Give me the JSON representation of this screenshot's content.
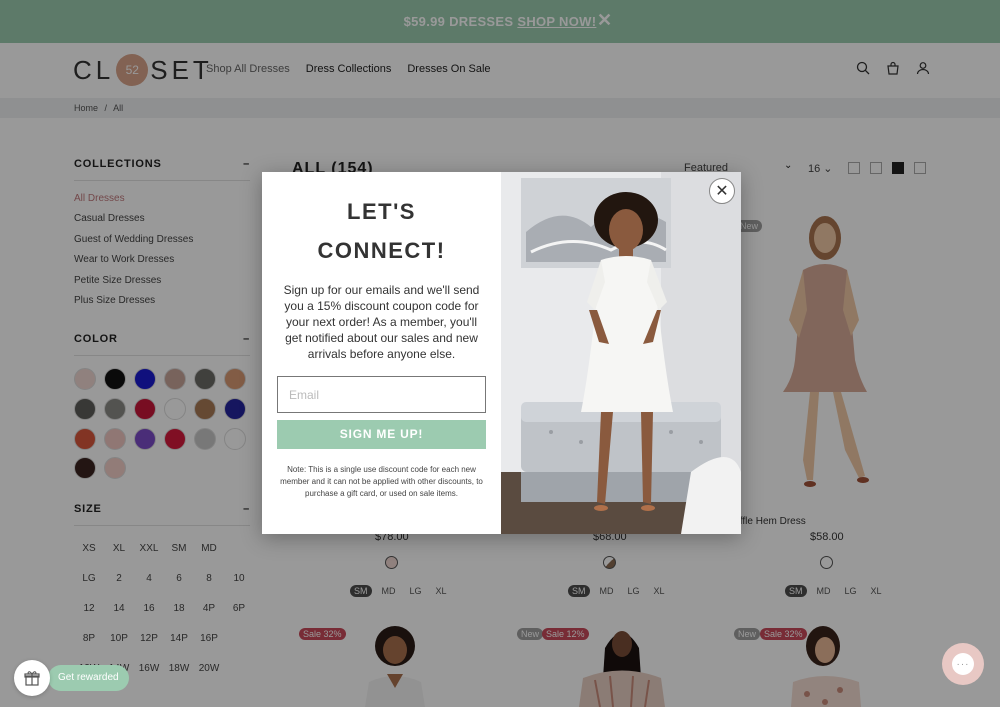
{
  "promo": {
    "text": "$59.99 DRESSES",
    "link": "SHOP NOW!",
    "close": "✕"
  },
  "header": {
    "logo_left": "CL",
    "logo_number": "52",
    "logo_right": "SET",
    "nav": [
      "Shop All Dresses",
      "Dress Collections",
      "Dresses On Sale"
    ],
    "icons": [
      "search-icon",
      "bag-icon",
      "account-icon"
    ]
  },
  "breadcrumb": {
    "home": "Home",
    "sep": "/",
    "current": "All"
  },
  "sidebar": {
    "collections_title": "COLLECTIONS",
    "collapse": "–",
    "collections": [
      "All Dresses",
      "Casual Dresses",
      "Guest of Wedding Dresses",
      "Wear to Work Dresses",
      "Petite Size Dresses",
      "Plus Size Dresses"
    ],
    "color_title": "COLOR",
    "colors": [
      "#f0d8d2",
      "#111111",
      "#1b1bd0",
      "#c9a59a",
      "#6b6b66",
      "#d99a73",
      "#5e5e5a",
      "#8a8a86",
      "#c8163a",
      "#ffffff",
      "#a87a55",
      "#26259e",
      "#d9583d",
      "#f1c6c1",
      "#7c4cc9",
      "#d61a3c",
      "#c9c9c9",
      "#ffffff",
      "#3b2421",
      "#f3cfc9"
    ],
    "size_title": "SIZE",
    "sizes": [
      "XS",
      "XL",
      "XXL",
      "SM",
      "MD",
      "",
      "LG",
      "2",
      "4",
      "6",
      "8",
      "10",
      "12",
      "14",
      "16",
      "18",
      "4P",
      "6P",
      "8P",
      "10P",
      "12P",
      "14P",
      "16P",
      "",
      "12W",
      "14W",
      "16W",
      "18W",
      "20W",
      ""
    ]
  },
  "main": {
    "title": "ALL (154)",
    "sort": "Featured",
    "per_page": "16 ⌄",
    "products": [
      {
        "name": "",
        "price": "$78.00",
        "color": "#f0d8d2",
        "sizes": [
          "SM",
          "MD",
          "LG",
          "XL"
        ]
      },
      {
        "name": "",
        "price": "$68.00",
        "color": "#8a6b52",
        "sizes": [
          "SM",
          "MD",
          "LG",
          "XL"
        ]
      },
      {
        "name": "Ruffle Hem Dress",
        "price": "$58.00",
        "color": "#ffffff",
        "sizes": [
          "SM",
          "MD",
          "LG",
          "XL"
        ]
      }
    ],
    "badges": {
      "new": "New",
      "sale32": "Sale 32%",
      "sale12": "Sale 12%"
    }
  },
  "modal": {
    "title1": "LET'S",
    "title2": "CONNECT!",
    "body": "Sign up for our emails and we'll send you a 15% discount coupon code for your next order! As a member, you'll get notified about our sales and new arrivals before anyone else.",
    "email_placeholder": "Email",
    "button": "SIGN ME UP!",
    "note": "Note: This is a single use discount code for each new member and it can not be applied with other discounts, to purchase a gift card, or used on sale items.",
    "close": "✕"
  },
  "widgets": {
    "rewards": "Get rewarded",
    "chat": "···"
  },
  "colors": {
    "accent": "#9ccbb0",
    "sale": "#c84a5a",
    "logo": "#d9a48a"
  }
}
